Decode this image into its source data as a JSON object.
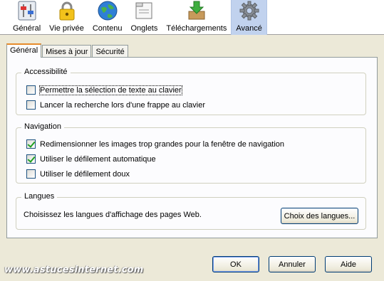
{
  "toolbar": {
    "items": [
      {
        "label": "Général",
        "icon": "sliders-icon"
      },
      {
        "label": "Vie privée",
        "icon": "padlock-icon"
      },
      {
        "label": "Contenu",
        "icon": "globe-icon"
      },
      {
        "label": "Onglets",
        "icon": "window-tabs-icon"
      },
      {
        "label": "Téléchargements",
        "icon": "download-box-icon"
      },
      {
        "label": "Avancé",
        "icon": "gear-icon",
        "selected": true
      }
    ]
  },
  "tabs": [
    {
      "label": "Général",
      "active": true
    },
    {
      "label": "Mises à jour"
    },
    {
      "label": "Sécurité"
    }
  ],
  "accessibility": {
    "title": "Accessibilité",
    "options": [
      {
        "label": "Permettre la sélection de texte au clavier",
        "checked": false
      },
      {
        "label": "Lancer la recherche lors d'une frappe au clavier",
        "checked": false
      }
    ]
  },
  "navigation": {
    "title": "Navigation",
    "options": [
      {
        "label": "Redimensionner les images trop grandes pour la fenêtre de navigation",
        "checked": true
      },
      {
        "label": "Utiliser le défilement automatique",
        "checked": true
      },
      {
        "label": "Utiliser le défilement doux",
        "checked": false
      }
    ]
  },
  "languages": {
    "title": "Langues",
    "description": "Choisissez les langues d'affichage des pages Web.",
    "button": "Choix des langues..."
  },
  "dialog_buttons": {
    "ok": "OK",
    "cancel": "Annuler",
    "help": "Aide"
  },
  "watermark": "www.astucesinternet.com",
  "colors": {
    "selected_toolbar": "#c1d2ee",
    "tab_accent": "#e68b2c",
    "window_bg": "#ece9d8"
  }
}
